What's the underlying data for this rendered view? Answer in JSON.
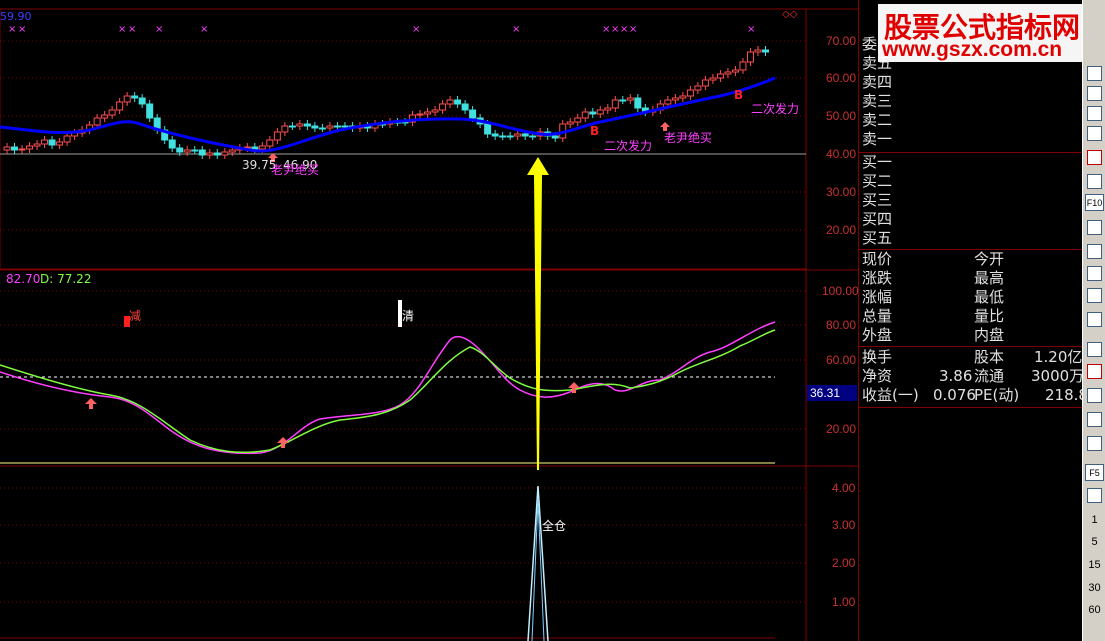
{
  "price_panel": {
    "top_left_value": "59.90",
    "y_ticks": [
      "70.00",
      "60.00",
      "50.00",
      "40.00",
      "30.00",
      "20.00"
    ],
    "low_label": "39.75",
    "high_label": "46.90",
    "annotations": {
      "buy1": "老尹绝买",
      "buy2": "老尹绝买",
      "second_burst1": "二次发力",
      "second_burst2": "二次发力",
      "b_mark": "B"
    },
    "diamond": "◇◇"
  },
  "kd_panel": {
    "k_label": "82.70",
    "d_label": "D: 77.22",
    "y_ticks": [
      "100.00",
      "80.00",
      "60.00",
      "40.00",
      "20.00"
    ],
    "current_value": "36.31",
    "marker_reduce": "减",
    "marker_clear": "清",
    "colors": {
      "k": "#ff40ff",
      "d": "#80ff40"
    }
  },
  "bottom_panel": {
    "y_ticks": [
      "4.00",
      "3.00",
      "2.00",
      "1.00"
    ],
    "signal_label": "全仓"
  },
  "quote": {
    "commission_ratio": "委",
    "asks": [
      "卖五",
      "卖四",
      "卖三",
      "卖二",
      "卖一"
    ],
    "bids": [
      "买一",
      "买二",
      "买三",
      "买四",
      "买五"
    ],
    "left_labels": [
      "现价",
      "涨跌",
      "涨幅",
      "总量",
      "外盘"
    ],
    "right_labels": [
      "今开",
      "最高",
      "最低",
      "量比",
      "内盘"
    ],
    "turnover_label": "换手",
    "net_asset_label": "净资",
    "net_asset_value": "3.86",
    "eps_label": "收益(一)",
    "eps_value": "0.076",
    "share_capital_label": "股本",
    "share_capital_value": "1.20亿",
    "float_label": "流通",
    "float_value": "3000万",
    "pe_label": "PE(动)",
    "pe_value": "218.8"
  },
  "watermark": {
    "title": "股票公式指标网",
    "url": "www.gszx.com.cn"
  },
  "toolbar": {
    "f10": "F10",
    "f5": "F5",
    "periods": [
      "1",
      "5",
      "15",
      "30",
      "60"
    ]
  }
}
